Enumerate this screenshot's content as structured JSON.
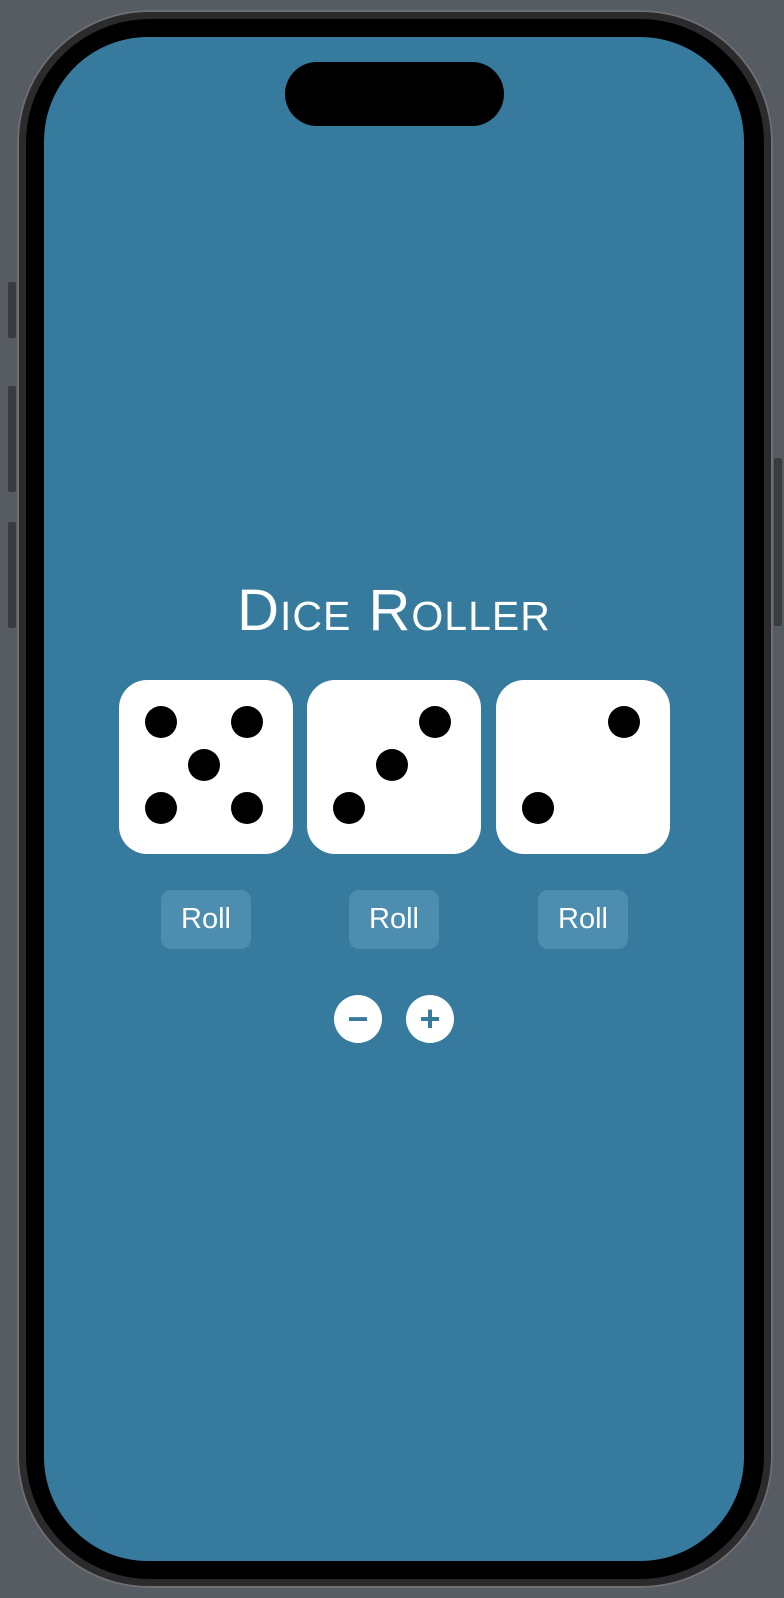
{
  "app": {
    "title": "Dice Roller",
    "background_color": "#367a9d"
  },
  "dice": [
    {
      "value": 5,
      "roll_label": "Roll"
    },
    {
      "value": 3,
      "roll_label": "Roll"
    },
    {
      "value": 2,
      "roll_label": "Roll"
    }
  ],
  "controls": {
    "decrease_icon": "minus-circle-icon",
    "decrease_symbol": "−",
    "increase_icon": "plus-circle-icon",
    "increase_symbol": "+"
  }
}
